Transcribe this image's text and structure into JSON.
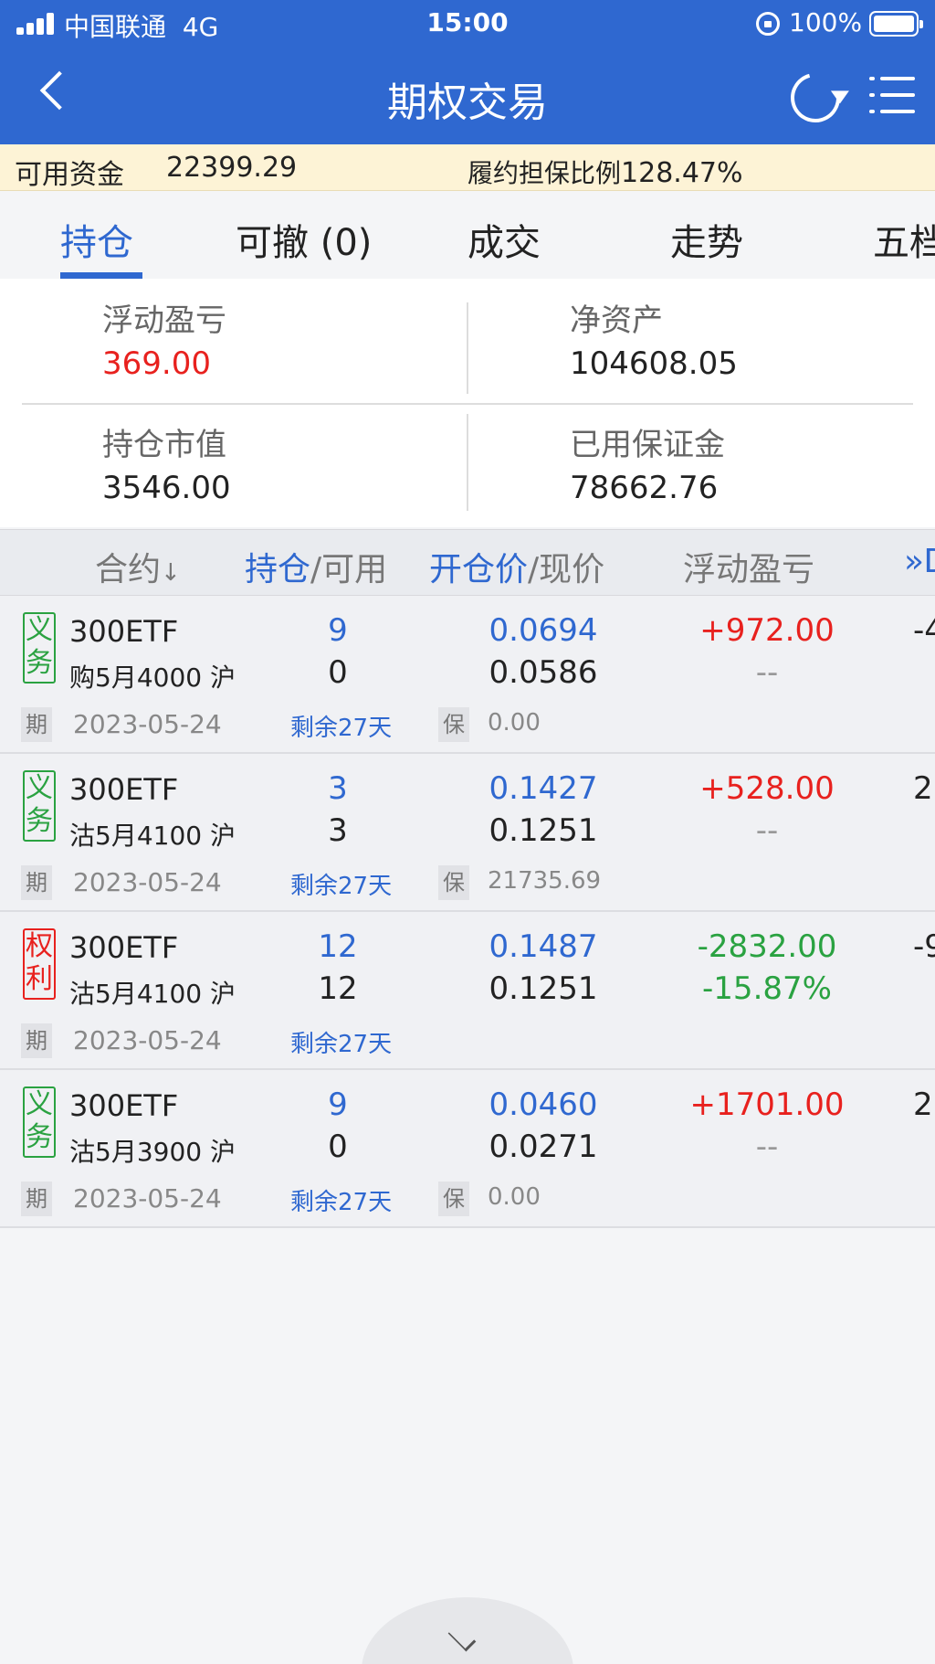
{
  "status_bar": {
    "carrier": "中国联通",
    "network": "4G",
    "time": "15:00",
    "battery": "100%",
    "icons": [
      "signal-icon",
      "orientation-lock-icon",
      "battery-icon"
    ]
  },
  "header": {
    "title": "期权交易",
    "icons": [
      "back-icon",
      "refresh-icon",
      "menu-icon"
    ],
    "background": "#2f68d0"
  },
  "funds": {
    "available_label": "可用资金",
    "available_value": "22399.29",
    "ratio_label": "履约担保比例",
    "ratio_value": "128.47%"
  },
  "tabs": [
    {
      "label": "持仓",
      "active": true
    },
    {
      "label": "可撤 (0)",
      "active": false
    },
    {
      "label": "成交",
      "active": false
    },
    {
      "label": "走势",
      "active": false
    },
    {
      "label": "五档",
      "active": false
    }
  ],
  "summary": {
    "floating_pnl_label": "浮动盈亏",
    "floating_pnl_value": "369.00",
    "net_assets_label": "净资产",
    "net_assets_value": "104608.05",
    "market_value_label": "持仓市值",
    "market_value_value": "3546.00",
    "margin_used_label": "已用保证金",
    "margin_used_value": "78662.76"
  },
  "table": {
    "header": {
      "contract": "合约",
      "sort_glyph": "↓",
      "position": "持仓",
      "available": "可用",
      "open_price": "开仓价",
      "current_price": "现价",
      "pnl": "浮动盈亏",
      "more": "»D",
      "sep": "/"
    },
    "rows": [
      {
        "tag": "义务",
        "tag_color": "green",
        "name": "300ETF",
        "sub": "购5月4000 沪",
        "position": "9",
        "available": "0",
        "open_price": "0.0694",
        "current_price": "0.0586",
        "pnl": "+972.00",
        "pnl_color": "red",
        "pnl2": "--",
        "pnl2_color": "gray",
        "extra": "-4",
        "date_badge": "期",
        "date": "2023-05-24",
        "remain": "剩余27天",
        "margin_badge": "保",
        "margin": "0.00"
      },
      {
        "tag": "义务",
        "tag_color": "green",
        "name": "300ETF",
        "sub": "沽5月4100 沪",
        "position": "3",
        "available": "3",
        "open_price": "0.1427",
        "current_price": "0.1251",
        "pnl": "+528.00",
        "pnl_color": "red",
        "pnl2": "--",
        "pnl2_color": "gray",
        "extra": "2",
        "date_badge": "期",
        "date": "2023-05-24",
        "remain": "剩余27天",
        "margin_badge": "保",
        "margin": "21735.69"
      },
      {
        "tag": "权利",
        "tag_color": "red",
        "name": "300ETF",
        "sub": "沽5月4100 沪",
        "position": "12",
        "available": "12",
        "open_price": "0.1487",
        "current_price": "0.1251",
        "pnl": "-2832.00",
        "pnl_color": "green",
        "pnl2": "-15.87%",
        "pnl2_color": "green",
        "extra": "-9",
        "date_badge": "期",
        "date": "2023-05-24",
        "remain": "剩余27天",
        "margin_badge": "",
        "margin": ""
      },
      {
        "tag": "义务",
        "tag_color": "green",
        "name": "300ETF",
        "sub": "沽5月3900 沪",
        "position": "9",
        "available": "0",
        "open_price": "0.0460",
        "current_price": "0.0271",
        "pnl": "+1701.00",
        "pnl_color": "red",
        "pnl2": "--",
        "pnl2_color": "gray",
        "extra": "2",
        "date_badge": "期",
        "date": "2023-05-24",
        "remain": "剩余27天",
        "margin_badge": "保",
        "margin": "0.00"
      }
    ]
  },
  "colors": {
    "accent": "#2f68d0",
    "up": "#e8211e",
    "down": "#2aa241",
    "funds_bg": "#fdf3d6"
  }
}
